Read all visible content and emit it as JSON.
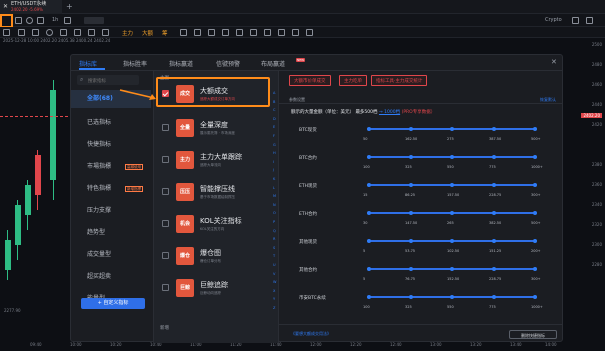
{
  "tab": {
    "title": "ETH/USDT永续",
    "sub": "2402.20 -5.69%"
  },
  "toolbar": {
    "interval": "1h",
    "labels": [
      "主力",
      "大额",
      "筹"
    ],
    "crypto": "Crypto"
  },
  "info": {
    "line1": "2025-12-28 10:00  2402.20  2405.38  2400.24  2402.24"
  },
  "prices": [
    "2500",
    "2480",
    "2460",
    "2440",
    "2420",
    "2402.20",
    "2380",
    "2360",
    "2340",
    "2320",
    "2300",
    "2280",
    "2277.90"
  ],
  "times": [
    "09:40",
    "10:00",
    "10:20",
    "10:40",
    "11:00",
    "11:20",
    "11:40",
    "12:00",
    "12:20",
    "12:40",
    "13:00",
    "13:20",
    "13:40",
    "14:00"
  ],
  "modal": {
    "tabs": [
      "指标库",
      "指标胜率",
      "指标赢道",
      "信號预警",
      "布局赢道"
    ],
    "new_badge": "NEW",
    "search_placeholder": "搜索指标",
    "nav": [
      "全部(68)",
      "已选指标",
      "快捷指标",
      "市場指標",
      "特色指標",
      "压力支撑",
      "趋势型",
      "成交量型",
      "超买超卖",
      "能量型"
    ],
    "nav_badges": {
      "3": "高頻使用",
      "4": "新增指標"
    },
    "add_button": "+ 自定义指标",
    "mid_header": "主图",
    "items": [
      {
        "icon": "成交",
        "name": "大额成交",
        "desc": "追踪大额成交订单方向",
        "checked": true
      },
      {
        "icon": "全量",
        "name": "全量深度",
        "desc": "展示委托簿 · 市场深度",
        "checked": false
      },
      {
        "icon": "主力",
        "name": "主力大单跟踪",
        "desc": "追踪大单流向",
        "checked": false
      },
      {
        "icon": "压压",
        "name": "智能撑压线",
        "desc": "基于市场数据绘制撑压",
        "checked": false
      },
      {
        "icon": "机会",
        "name": "KOL关注指标",
        "desc": "KOL关注的方向",
        "checked": false
      },
      {
        "icon": "爆仓",
        "name": "爆仓图",
        "desc": "爆仓订单分布",
        "checked": false
      },
      {
        "icon": "巨鲸",
        "name": "巨鲸追踪",
        "desc": "巨鲸动向追踪",
        "checked": false
      }
    ],
    "scroll_letters": [
      "A",
      "B",
      "C",
      "D",
      "E",
      "F",
      "G",
      "H",
      "I",
      "J",
      "K",
      "L",
      "M",
      "N",
      "O",
      "P",
      "Q",
      "R",
      "S",
      "T",
      "U",
      "V",
      "W",
      "X",
      "Y",
      "Z"
    ],
    "new_footer": "新增",
    "right_tabs": [
      "大额市价单成交",
      "主力吃单",
      "指标工具·主力成交统计"
    ],
    "param_header": "参数设置",
    "param_link": "恢复默认",
    "desc_prefix": "额示的大量金额",
    "desc_unit": "（单位：美元）",
    "desc_mid": "最多500档",
    "desc_hl": "→ 1000档",
    "desc_red": "(PRO专享数据）",
    "rows": [
      {
        "label": "BTC现货",
        "vals": [
          "50",
          "162.50",
          "275",
          "387.50",
          "500+"
        ]
      },
      {
        "label": "BTC合约",
        "vals": [
          "100",
          "325",
          "550",
          "775",
          "1000+"
        ]
      },
      {
        "label": "ETH现货",
        "vals": [
          "15",
          "86.25",
          "157.50",
          "228.75",
          "300+"
        ]
      },
      {
        "label": "ETH合约",
        "vals": [
          "30",
          "147.50",
          "265",
          "382.50",
          "500+"
        ]
      },
      {
        "label": "其他现货",
        "vals": [
          "5",
          "53.75",
          "102.50",
          "151.25",
          "200+"
        ]
      },
      {
        "label": "其他合约",
        "vals": [
          "5",
          "76.75",
          "152.50",
          "228.75",
          "300+"
        ]
      },
      {
        "label": "币安BTC永续",
        "vals": [
          "100",
          "325",
          "550",
          "775",
          "1000+"
        ]
      }
    ],
    "footer_link": "《要想大额成交用法》",
    "footer_button": "删除快捷指标"
  },
  "colors": {
    "accent": "#2f7cf6",
    "highlight": "#ff8c1a",
    "down": "#e0464b",
    "up": "#2ebd85"
  }
}
